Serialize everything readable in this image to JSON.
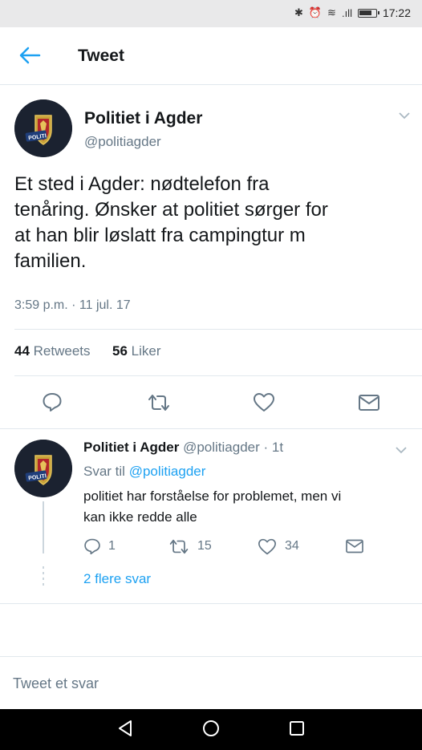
{
  "status_bar": {
    "time": "17:22"
  },
  "header": {
    "title": "Tweet",
    "back_icon": "arrow-left-icon"
  },
  "tweet": {
    "author_name": "Politiet i Agder",
    "author_handle": "@politiagder",
    "text_lines": [
      "Et sted i Agder: nødtelefon fra",
      "tenåring. Ønsker at politiet sørger for",
      "at han blir løslatt fra campingtur m",
      "familien."
    ],
    "timestamp": "3:59 p.m. · 11 jul. 17",
    "retweets_count": "44",
    "retweets_label": "Retweets",
    "likes_count": "56",
    "likes_label": "Liker",
    "actions": [
      "reply-icon",
      "retweet-icon",
      "heart-icon",
      "mail-icon"
    ]
  },
  "reply": {
    "author_name": "Politiet i Agder",
    "author_handle": "@politiagder",
    "age": "· 1t",
    "reply_to_prefix": "Svar til",
    "reply_to_handle": "@politiagder",
    "text_lines": [
      "politiet har forståelse for problemet, men vi",
      "kan ikke redde alle"
    ],
    "reply_count": "1",
    "retweet_count": "15",
    "like_count": "34",
    "more_replies": "2 flere svar"
  },
  "compose": {
    "placeholder": "Tweet et svar"
  },
  "colors": {
    "accent": "#1da1f2",
    "muted": "#657786",
    "text": "#14171a"
  }
}
